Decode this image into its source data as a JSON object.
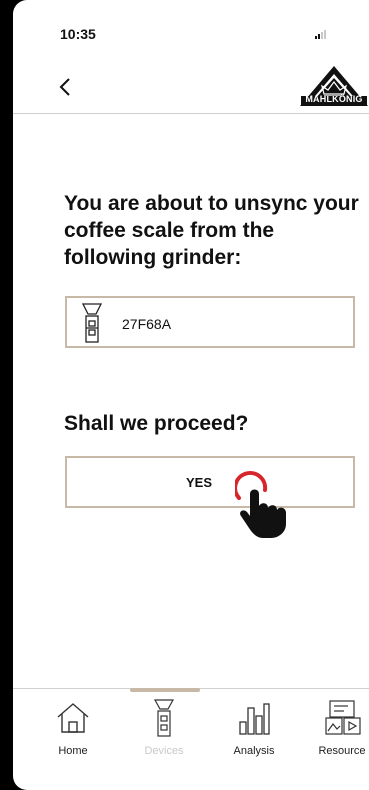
{
  "status_bar": {
    "time": "10:35"
  },
  "header": {
    "logo_text": "MAHLKÖNIG"
  },
  "main": {
    "heading": "You are about to unsync your coffee scale from the following grinder:",
    "device_id": "27F68A",
    "question": "Shall we proceed?",
    "yes_label": "YES"
  },
  "nav": {
    "items": [
      {
        "label": "Home",
        "icon": "home-icon"
      },
      {
        "label": "Devices",
        "icon": "grinder-icon",
        "active": true
      },
      {
        "label": "Analysis",
        "icon": "bar-chart-icon"
      },
      {
        "label": "Resource",
        "icon": "resources-icon"
      }
    ]
  },
  "colors": {
    "accent_border": "#c8b8a6",
    "tap_ring": "#d7262b",
    "inactive_label": "#c9c9c9"
  }
}
